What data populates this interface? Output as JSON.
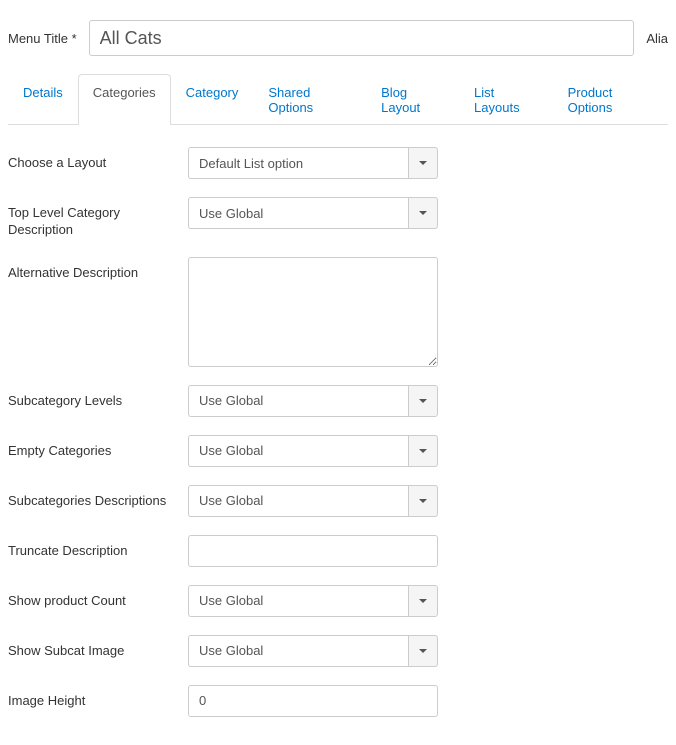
{
  "header": {
    "menu_title_label": "Menu Title *",
    "menu_title_value": "All Cats",
    "alias_label": "Alia"
  },
  "tabs": [
    {
      "label": "Details",
      "active": false
    },
    {
      "label": "Categories",
      "active": true
    },
    {
      "label": "Category",
      "active": false
    },
    {
      "label": "Shared Options",
      "active": false
    },
    {
      "label": "Blog Layout",
      "active": false
    },
    {
      "label": "List Layouts",
      "active": false
    },
    {
      "label": "Product Options",
      "active": false
    }
  ],
  "form": {
    "choose_layout": {
      "label": "Choose a Layout",
      "value": "Default List option"
    },
    "top_level_desc": {
      "label": "Top Level Category Description",
      "value": "Use Global"
    },
    "alt_desc": {
      "label": "Alternative Description",
      "value": ""
    },
    "subcat_levels": {
      "label": "Subcategory Levels",
      "value": "Use Global"
    },
    "empty_categories": {
      "label": "Empty Categories",
      "value": "Use Global"
    },
    "subcat_descriptions": {
      "label": "Subcategories Descriptions",
      "value": "Use Global"
    },
    "truncate_desc": {
      "label": "Truncate Description",
      "value": ""
    },
    "show_product_count": {
      "label": "Show product Count",
      "value": "Use Global"
    },
    "show_subcat_image": {
      "label": "Show Subcat Image",
      "value": "Use Global"
    },
    "image_height": {
      "label": "Image Height",
      "value": "0"
    }
  }
}
